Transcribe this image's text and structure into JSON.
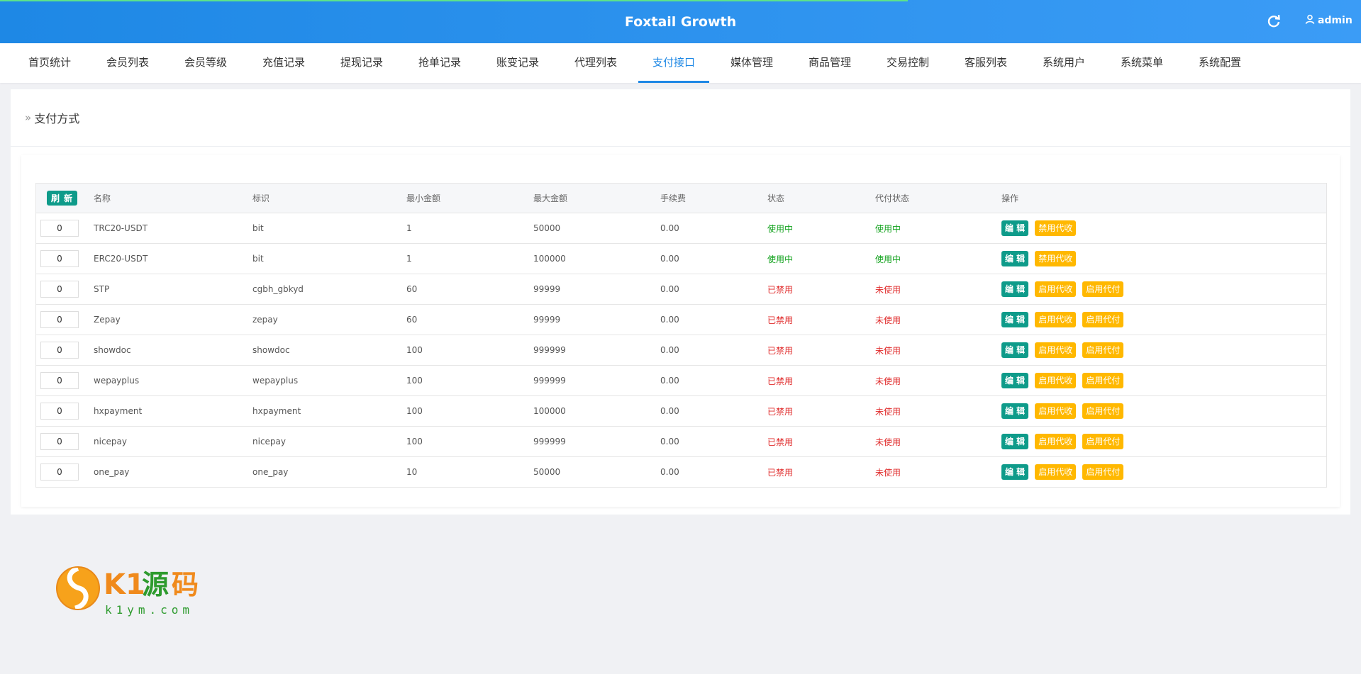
{
  "header": {
    "title": "Foxtail Growth",
    "user": "admin"
  },
  "nav": {
    "tabs": [
      "首页统计",
      "会员列表",
      "会员等级",
      "充值记录",
      "提现记录",
      "抢单记录",
      "账变记录",
      "代理列表",
      "支付接口",
      "媒体管理",
      "商品管理",
      "交易控制",
      "客服列表",
      "系统用户",
      "系统菜单",
      "系统配置"
    ],
    "active": "支付接口"
  },
  "breadcrumb": "支付方式",
  "table": {
    "refresh_label": "刷 新",
    "columns": [
      "名称",
      "标识",
      "最小金额",
      "最大金额",
      "手续费",
      "状态",
      "代付状态",
      "操作"
    ],
    "rows": [
      {
        "sort": "0",
        "name": "TRC20-USDT",
        "code": "bit",
        "min": "1",
        "max": "50000",
        "fee": "0.00",
        "status": "使用中",
        "payout": "使用中",
        "actions": [
          "编 辑",
          "禁用代收"
        ]
      },
      {
        "sort": "0",
        "name": "ERC20-USDT",
        "code": "bit",
        "min": "1",
        "max": "100000",
        "fee": "0.00",
        "status": "使用中",
        "payout": "使用中",
        "actions": [
          "编 辑",
          "禁用代收"
        ]
      },
      {
        "sort": "0",
        "name": "STP",
        "code": "cgbh_gbkyd",
        "min": "60",
        "max": "99999",
        "fee": "0.00",
        "status": "已禁用",
        "payout": "未使用",
        "actions": [
          "编 辑",
          "启用代收",
          "启用代付"
        ]
      },
      {
        "sort": "0",
        "name": "Zepay",
        "code": "zepay",
        "min": "60",
        "max": "99999",
        "fee": "0.00",
        "status": "已禁用",
        "payout": "未使用",
        "actions": [
          "编 辑",
          "启用代收",
          "启用代付"
        ]
      },
      {
        "sort": "0",
        "name": "showdoc",
        "code": "showdoc",
        "min": "100",
        "max": "999999",
        "fee": "0.00",
        "status": "已禁用",
        "payout": "未使用",
        "actions": [
          "编 辑",
          "启用代收",
          "启用代付"
        ]
      },
      {
        "sort": "0",
        "name": "wepayplus",
        "code": "wepayplus",
        "min": "100",
        "max": "999999",
        "fee": "0.00",
        "status": "已禁用",
        "payout": "未使用",
        "actions": [
          "编 辑",
          "启用代收",
          "启用代付"
        ]
      },
      {
        "sort": "0",
        "name": "hxpayment",
        "code": "hxpayment",
        "min": "100",
        "max": "100000",
        "fee": "0.00",
        "status": "已禁用",
        "payout": "未使用",
        "actions": [
          "编 辑",
          "启用代收",
          "启用代付"
        ]
      },
      {
        "sort": "0",
        "name": "nicepay",
        "code": "nicepay",
        "min": "100",
        "max": "999999",
        "fee": "0.00",
        "status": "已禁用",
        "payout": "未使用",
        "actions": [
          "编 辑",
          "启用代收",
          "启用代付"
        ]
      },
      {
        "sort": "0",
        "name": "one_pay",
        "code": "one_pay",
        "min": "10",
        "max": "50000",
        "fee": "0.00",
        "status": "已禁用",
        "payout": "未使用",
        "actions": [
          "编 辑",
          "启用代收",
          "启用代付"
        ]
      }
    ]
  },
  "watermark": {
    "text_main": "K1源码",
    "text_sub": "k1ym.com"
  },
  "colors": {
    "header": "#1e88e5",
    "active_status": "#12a21d",
    "disabled_status": "#e02b2b",
    "edit_button": "#0e9b8a",
    "toggle_button": "#ffb800"
  }
}
